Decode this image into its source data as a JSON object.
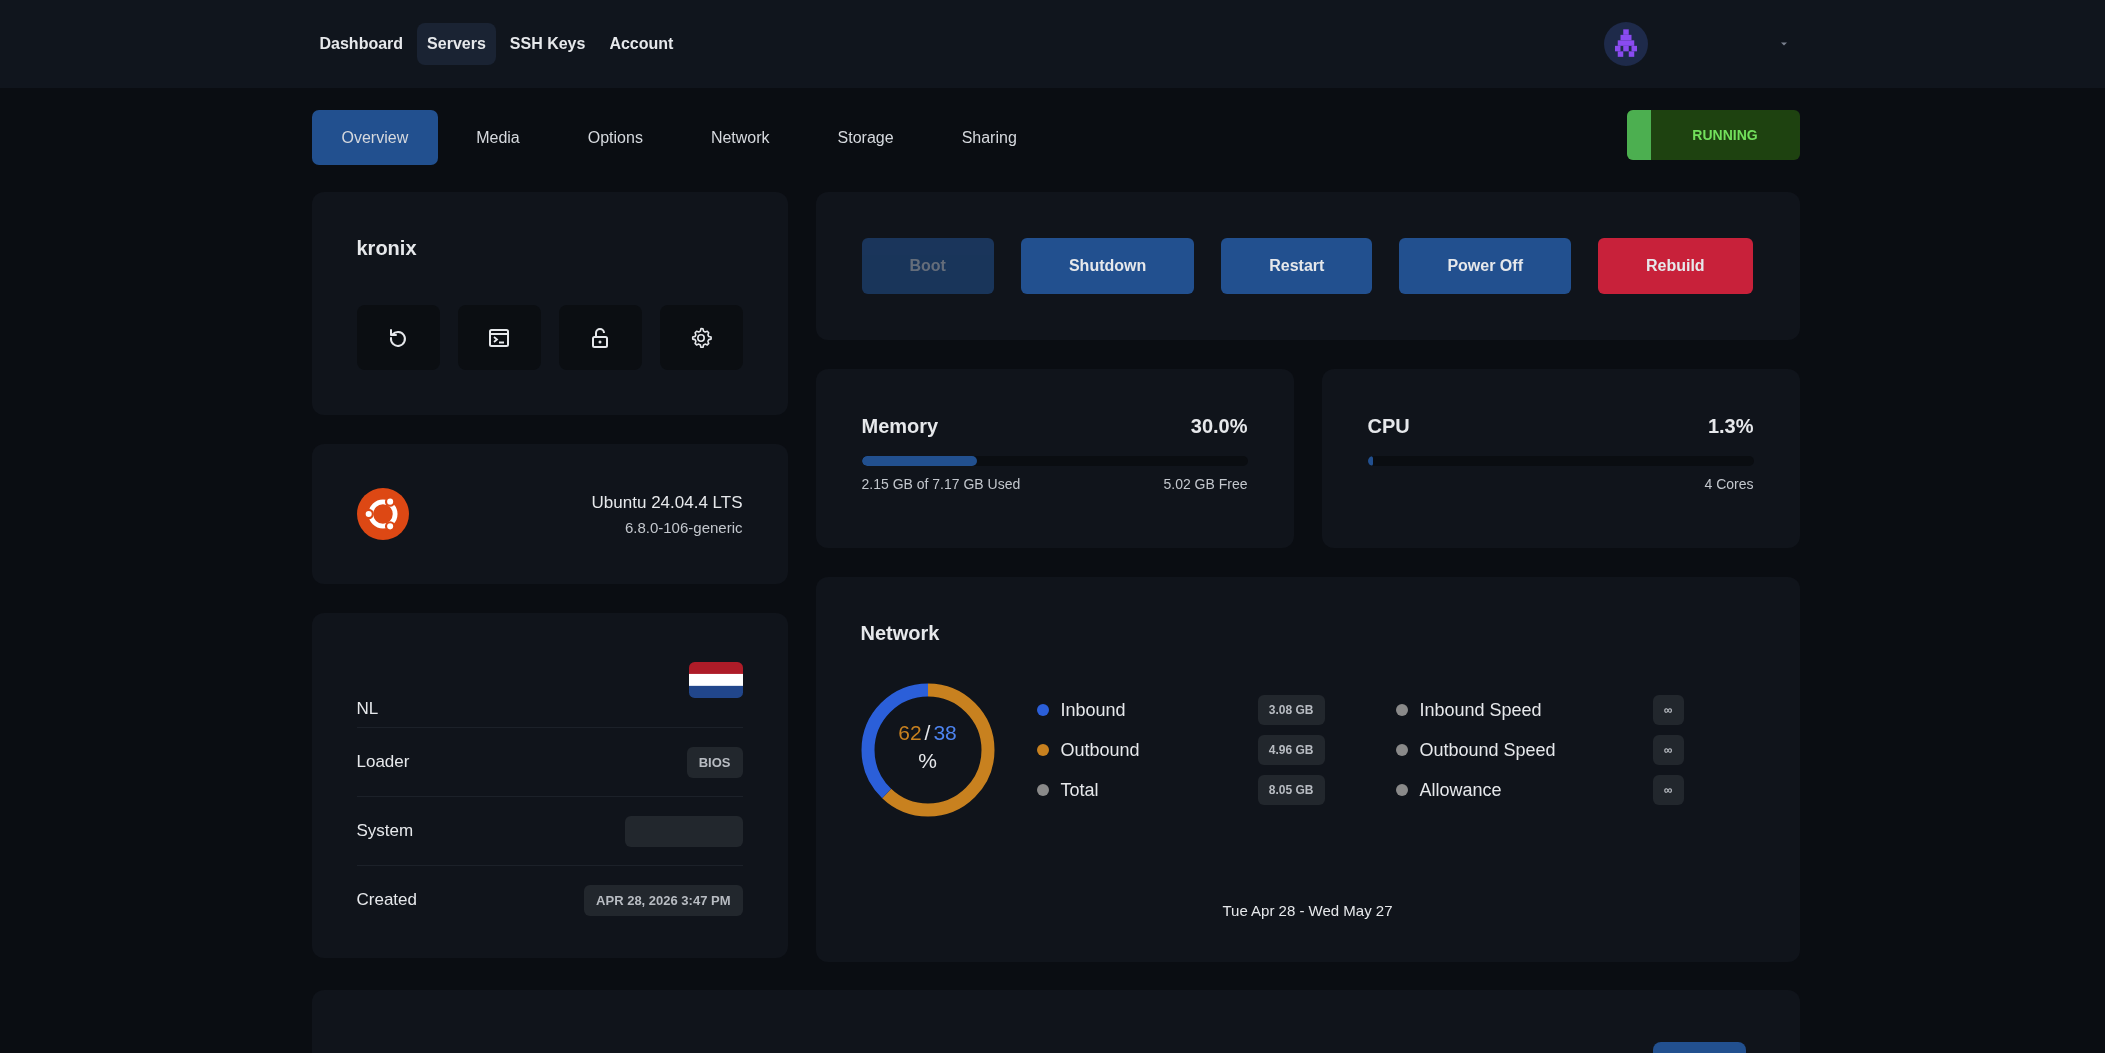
{
  "nav": {
    "links": [
      {
        "label": "Dashboard",
        "selected": false
      },
      {
        "label": "Servers",
        "selected": true
      },
      {
        "label": "SSH Keys",
        "selected": false
      },
      {
        "label": "Account",
        "selected": false
      }
    ]
  },
  "tabs": [
    {
      "label": "Overview",
      "selected": true
    },
    {
      "label": "Media",
      "selected": false
    },
    {
      "label": "Options",
      "selected": false
    },
    {
      "label": "Network",
      "selected": false
    },
    {
      "label": "Storage",
      "selected": false
    },
    {
      "label": "Sharing",
      "selected": false
    }
  ],
  "status": {
    "label": "RUNNING",
    "active": true
  },
  "server": {
    "name": "kronix",
    "tools": [
      {
        "kind": "reinstall"
      },
      {
        "kind": "console"
      },
      {
        "kind": "unlock"
      },
      {
        "kind": "settings"
      }
    ]
  },
  "os": {
    "name": "Ubuntu 24.04.4 LTS",
    "kernel": "6.8.0-106-generic"
  },
  "details": [
    {
      "label": "NL",
      "kind": "flag"
    },
    {
      "label": "Loader",
      "kind": "badge",
      "value": "BIOS"
    },
    {
      "label": "System",
      "kind": "badge"
    },
    {
      "label": "Created",
      "kind": "badge",
      "value": "APR 28, 2026 3:47 PM"
    }
  ],
  "actions": [
    {
      "label": "Boot",
      "kind": "primary",
      "disabled": true
    },
    {
      "label": "Shutdown",
      "kind": "primary",
      "disabled": false
    },
    {
      "label": "Restart",
      "kind": "primary",
      "disabled": false
    },
    {
      "label": "Power Off",
      "kind": "primary",
      "disabled": false
    },
    {
      "label": "Rebuild",
      "kind": "danger",
      "disabled": false
    }
  ],
  "memory": {
    "title": "Memory",
    "percent": "30.0%",
    "level": 0.3,
    "used": "2.15 GB of 7.17 GB Used",
    "free": "5.02 GB Free"
  },
  "cpu": {
    "title": "CPU",
    "percent": "1.3%",
    "level": 0.013,
    "cores": "4 Cores"
  },
  "network": {
    "title": "Network",
    "center": {
      "outbound": "62",
      "separator": "/",
      "inbound": "38",
      "unit": "%"
    },
    "legend": [
      {
        "label": "Inbound",
        "value": "3.08 GB",
        "color": "#2b5fd9"
      },
      {
        "label": "Outbound",
        "value": "4.96 GB",
        "color": "#c8811f"
      },
      {
        "label": "Total",
        "value": "8.05 GB",
        "color": "#8a8a8a"
      }
    ],
    "limits": [
      {
        "label": "Inbound Speed",
        "value": "∞",
        "color": "#8a8a8a"
      },
      {
        "label": "Outbound Speed",
        "value": "∞",
        "color": "#8a8a8a"
      },
      {
        "label": "Allowance",
        "value": "∞",
        "color": "#8a8a8a"
      }
    ],
    "period": "Tue Apr 28 - Wed May 27"
  }
}
